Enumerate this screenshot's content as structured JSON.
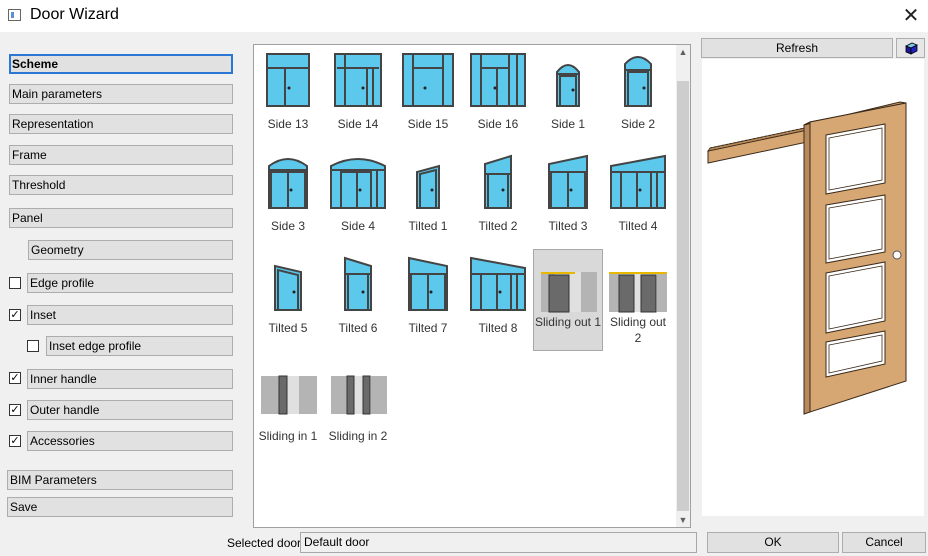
{
  "window": {
    "title": "Door Wizard"
  },
  "sidebar": {
    "items": [
      {
        "label": "Scheme"
      },
      {
        "label": "Main parameters"
      },
      {
        "label": "Representation"
      },
      {
        "label": "Frame"
      },
      {
        "label": "Threshold"
      },
      {
        "label": "Panel"
      },
      {
        "label": "Geometry"
      },
      {
        "label": "Edge profile",
        "checked": false
      },
      {
        "label": "Inset",
        "checked": true
      },
      {
        "label": "Inset edge profile",
        "checked": false
      },
      {
        "label": "Inner handle",
        "checked": true
      },
      {
        "label": "Outer handle",
        "checked": true
      },
      {
        "label": "Accessories",
        "checked": true
      },
      {
        "label": "BIM Parameters"
      },
      {
        "label": "Save"
      }
    ]
  },
  "gallery": {
    "items": [
      {
        "label": "Side 13",
        "icon": "door-side-13-icon"
      },
      {
        "label": "Side 14",
        "icon": "door-side-14-icon"
      },
      {
        "label": "Side 15",
        "icon": "door-side-15-icon"
      },
      {
        "label": "Side 16",
        "icon": "door-side-16-icon"
      },
      {
        "label": "Side 1",
        "icon": "door-side-1-icon"
      },
      {
        "label": "Side 2",
        "icon": "door-side-2-icon"
      },
      {
        "label": "Side 3",
        "icon": "door-side-3-icon"
      },
      {
        "label": "Side 4",
        "icon": "door-side-4-icon"
      },
      {
        "label": "Tilted 1",
        "icon": "door-tilted-1-icon"
      },
      {
        "label": "Tilted 2",
        "icon": "door-tilted-2-icon"
      },
      {
        "label": "Tilted 3",
        "icon": "door-tilted-3-icon"
      },
      {
        "label": "Tilted 4",
        "icon": "door-tilted-4-icon"
      },
      {
        "label": "Tilted 5",
        "icon": "door-tilted-5-icon"
      },
      {
        "label": "Tilted 6",
        "icon": "door-tilted-6-icon"
      },
      {
        "label": "Tilted 7",
        "icon": "door-tilted-7-icon"
      },
      {
        "label": "Tilted 8",
        "icon": "door-tilted-8-icon"
      },
      {
        "label": "Sliding out 1",
        "icon": "sliding-out-1-icon",
        "selected": true
      },
      {
        "label": "Sliding out 2",
        "icon": "sliding-out-2-icon"
      },
      {
        "label": "Sliding in 1",
        "icon": "sliding-in-1-icon"
      },
      {
        "label": "Sliding in 2",
        "icon": "sliding-in-2-icon"
      }
    ]
  },
  "preview": {
    "refresh_label": "Refresh",
    "view_icon": "cube-view-icon"
  },
  "footer": {
    "selected_label": "Selected door",
    "selected_value": "Default door",
    "ok_label": "OK",
    "cancel_label": "Cancel"
  },
  "colors": {
    "glass": "#5bc8ec",
    "frame": "#555555",
    "door_wood": "#d6a673",
    "accent": "#2a78d4"
  }
}
